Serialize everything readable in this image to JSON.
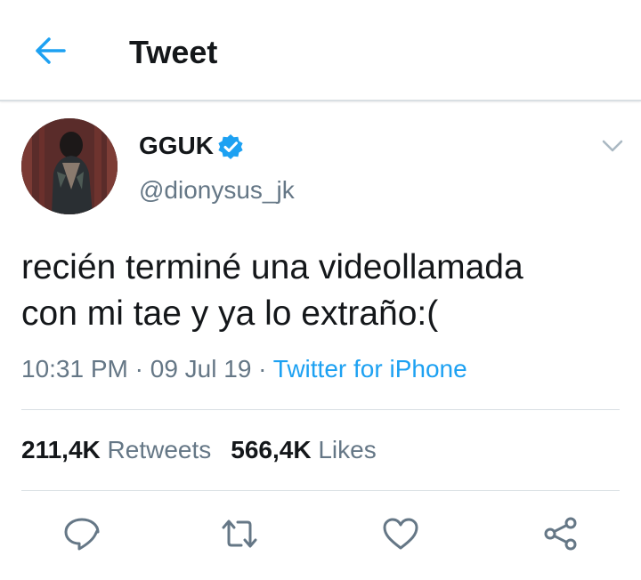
{
  "header": {
    "title": "Tweet",
    "back_icon": "back-arrow-icon"
  },
  "author": {
    "display_name": "GGUK",
    "handle": "@dionysus_jk",
    "verified": true
  },
  "tweet": {
    "text_line1": "recién terminé una videollamada",
    "text_line2": "con mi tae y ya lo extraño:(",
    "time": "10:31 PM",
    "date": "09 Jul 19",
    "separator": " · ",
    "source": "Twitter for iPhone"
  },
  "stats": {
    "retweets_count": "211,4K",
    "retweets_label": "Retweets",
    "likes_count": "566,4K",
    "likes_label": "Likes"
  },
  "actions": [
    "reply-icon",
    "retweet-icon",
    "like-icon",
    "share-icon"
  ],
  "colors": {
    "accent": "#1da1f2",
    "muted": "#657786",
    "text": "#14171a",
    "divider": "#d9dfe3"
  }
}
